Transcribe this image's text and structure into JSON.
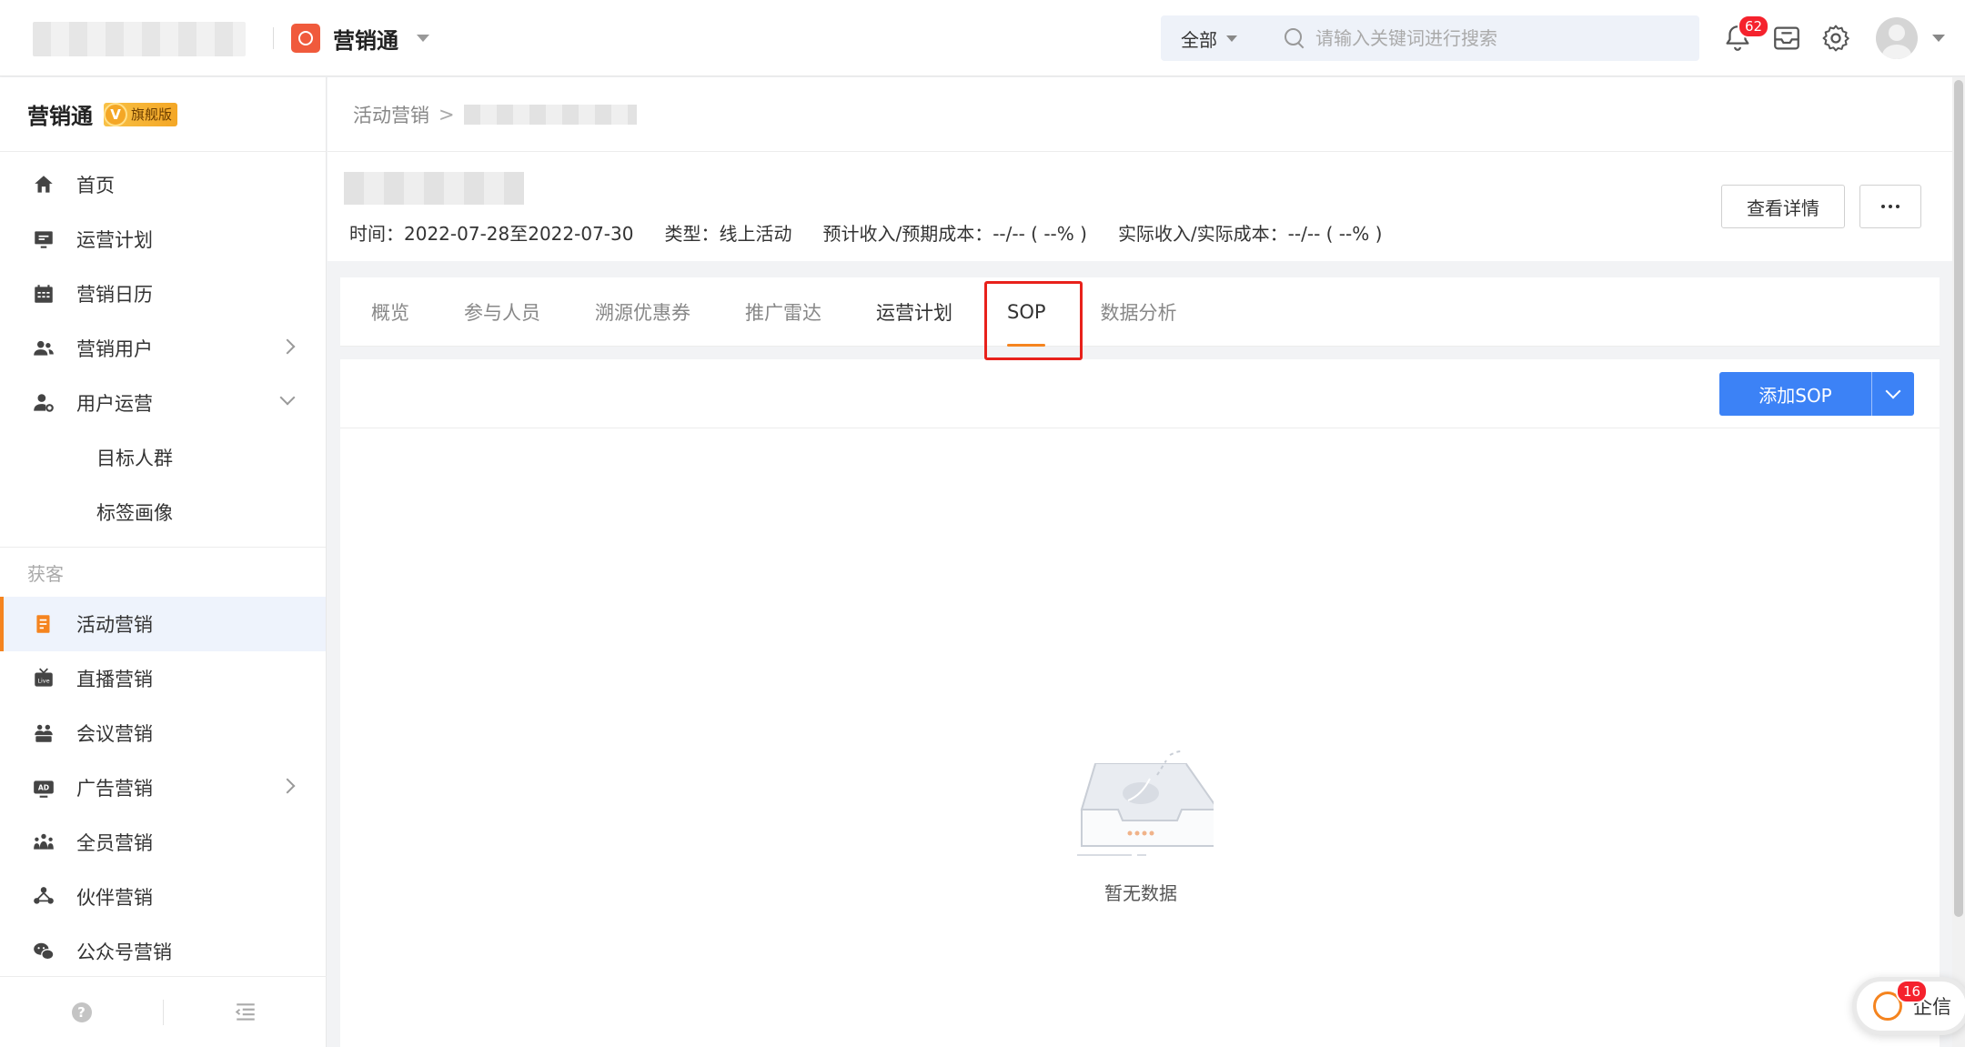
{
  "header": {
    "product_name": "营销通",
    "search": {
      "scope": "全部",
      "placeholder": "请输入关键词进行搜索"
    },
    "notifications_count": "62"
  },
  "sidebar": {
    "brand": "营销通",
    "edition_badge": "旗舰版",
    "edition_badge_letter": "V",
    "items": [
      {
        "label": "首页"
      },
      {
        "label": "运营计划"
      },
      {
        "label": "营销日历"
      },
      {
        "label": "营销用户"
      },
      {
        "label": "用户运营"
      },
      {
        "label": "目标人群"
      },
      {
        "label": "标签画像"
      }
    ],
    "section_label": "获客",
    "section_items": [
      {
        "label": "活动营销"
      },
      {
        "label": "直播营销"
      },
      {
        "label": "会议营销"
      },
      {
        "label": "广告营销"
      },
      {
        "label": "全员营销"
      },
      {
        "label": "伙伴营销"
      },
      {
        "label": "公众号营销"
      }
    ],
    "footer_help": "?"
  },
  "breadcrumb": {
    "root": "活动营销",
    "separator": ">"
  },
  "activity": {
    "meta": {
      "time": "时间：2022-07-28至2022-07-30",
      "type": "类型：线上活动",
      "expected": "预计收入/预期成本：--/-- ( --% )",
      "actual": "实际收入/实际成本：--/-- ( --% )"
    },
    "detail_button": "查看详情"
  },
  "tabs": [
    {
      "label": "概览"
    },
    {
      "label": "参与人员"
    },
    {
      "label": "溯源优惠券"
    },
    {
      "label": "推广雷达"
    },
    {
      "label": "运营计划"
    },
    {
      "label": "SOP"
    },
    {
      "label": "数据分析"
    }
  ],
  "content": {
    "add_button": "添加SOP",
    "empty_text": "暂无数据"
  },
  "float_chat": {
    "badge": "16",
    "label": "企信"
  },
  "colors": {
    "accent_orange": "#f5841f",
    "primary_blue": "#3c82f6",
    "badge_red": "#f5222d",
    "highlight_red": "#e8211b"
  }
}
